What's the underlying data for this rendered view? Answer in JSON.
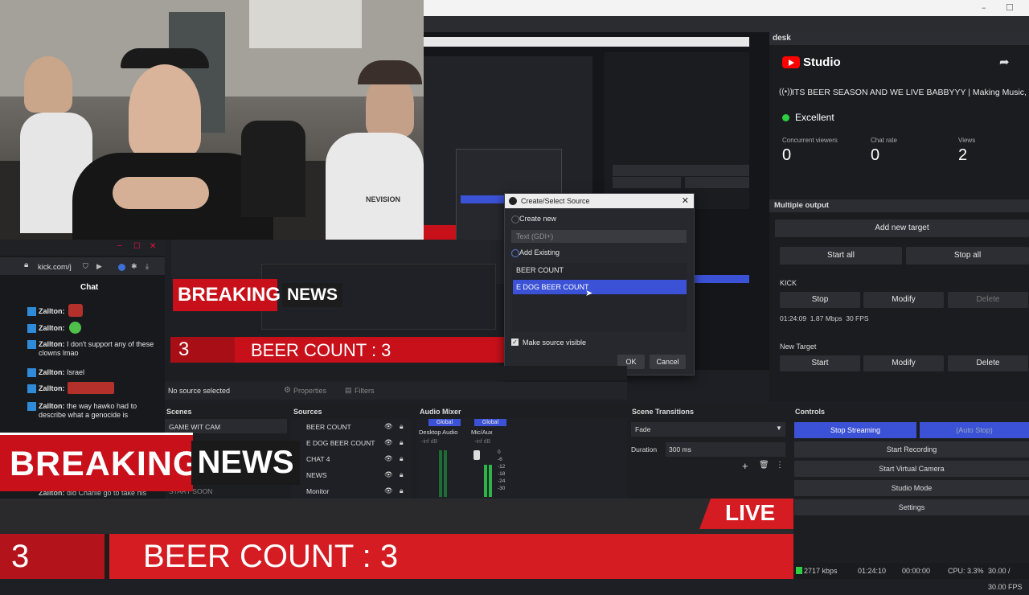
{
  "studio": {
    "window_title": "desk",
    "brand": "Studio",
    "stream_title": "ITS BEER SEASON AND WE LIVE BABBYYY | Making Music, Lo...",
    "status": "Excellent",
    "stats": [
      {
        "label": "Concurrent viewers",
        "value": "0"
      },
      {
        "label": "Chat rate",
        "value": "0"
      },
      {
        "label": "Views",
        "value": "2"
      }
    ],
    "multiple_output": {
      "heading": "Multiple output",
      "add_target": "Add new target",
      "start_all": "Start all",
      "stop_all": "Stop all",
      "targets": [
        {
          "name": "KICK",
          "b1": "Stop",
          "b2": "Modify",
          "b3": "Delete",
          "stats": "01:24:09  1.87 Mbps  30 FPS"
        },
        {
          "name": "New Target",
          "b1": "Start",
          "b2": "Modify",
          "b3": "Delete"
        }
      ]
    }
  },
  "dialog": {
    "title": "Create/Select Source",
    "create_new": "Create new",
    "new_placeholder": "Text (GDI+)",
    "add_existing": "Add Existing",
    "existing": [
      "BEER COUNT",
      "E DOG BEER COUNT"
    ],
    "make_visible": "Make source visible",
    "ok": "OK",
    "cancel": "Cancel"
  },
  "chat": {
    "url": "kick.com/j",
    "heading": "Chat",
    "messages": [
      {
        "user": "Zallton:",
        "text": ""
      },
      {
        "user": "Zallton:",
        "text": ""
      },
      {
        "user": "Zallton:",
        "text": "I don't support any of these clowns lmao"
      },
      {
        "user": "Zallton:",
        "text": "Israel"
      },
      {
        "user": "Zallton:",
        "text": ""
      },
      {
        "user": "Zallton:",
        "text": "the way hawko had to describe what a genocide is"
      },
      {
        "user": "Zallton:",
        "text": "did Charlie go to take his"
      }
    ]
  },
  "obs": {
    "no_source": "No source selected",
    "properties": "Properties",
    "filters": "Filters",
    "scenes_heading": "Scenes",
    "scenes": [
      "GAME WIT CAM",
      "START SOON"
    ],
    "sources_heading": "Sources",
    "sources": [
      "BEER COUNT",
      "E DOG BEER COUNT",
      "CHAT 4",
      "NEWS",
      "Monitor"
    ],
    "audio_heading": "Audio Mixer",
    "audio_channels": [
      {
        "name": "Desktop Audio",
        "tag": "Global"
      },
      {
        "name": "Mic/Aux",
        "tag": "Global"
      }
    ],
    "audio_db": "-inf dB",
    "meter_ticks": [
      "0",
      "-6",
      "-12",
      "-18",
      "-24",
      "-30"
    ],
    "transitions_heading": "Scene Transitions",
    "transition": "Fade",
    "duration_label": "Duration",
    "duration": "300 ms",
    "controls_heading": "Controls",
    "controls": [
      "Stop Streaming",
      "Start Recording",
      "Start Virtual Camera",
      "Studio Mode",
      "Settings"
    ],
    "auto_stop": "(Auto Stop)",
    "status": {
      "kbps": "2717 kbps",
      "time": "01:24:10",
      "rec": "00:00:00",
      "cpu": "CPU: 3.3%",
      "fps": "30.00 / 30.00 FPS"
    }
  },
  "overlay": {
    "breaking": "BREAKING",
    "news": "NEWS",
    "count_num": "3",
    "beer_count": "BEER COUNT : 3",
    "live": "LIVE"
  },
  "webcam": {
    "hoodie_text": "NEVISION"
  },
  "colors": {
    "accent_red": "#d41c22",
    "obs_blue": "#3b52d6",
    "excellent": "#2ecc40"
  }
}
